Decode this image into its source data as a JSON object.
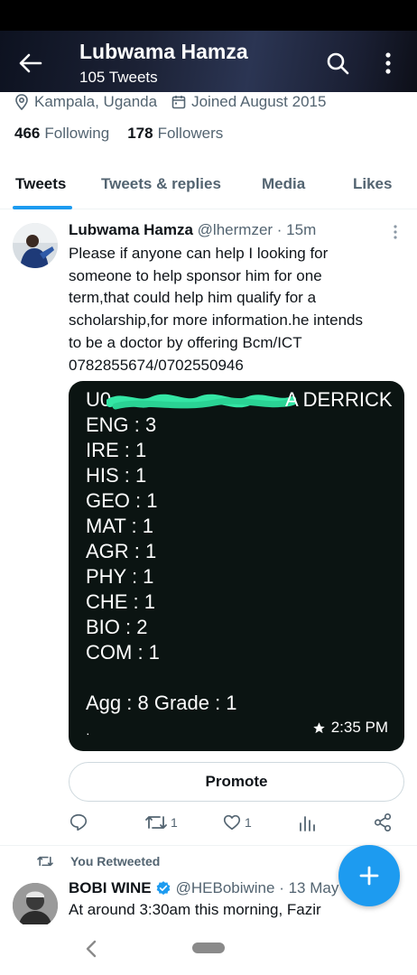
{
  "header": {
    "name": "Lubwama Hamza",
    "tweet_count": "105 Tweets",
    "back_icon": "arrow-left-icon",
    "search_icon": "search-icon",
    "more_icon": "more-vertical-icon"
  },
  "profile": {
    "location": "Kampala, Uganda",
    "joined": "Joined August 2015",
    "following_count": "466",
    "following_label": "Following",
    "followers_count": "178",
    "followers_label": "Followers"
  },
  "tabs": [
    {
      "label": "Tweets",
      "active": true
    },
    {
      "label": "Tweets & replies",
      "active": false
    },
    {
      "label": "Media",
      "active": false
    },
    {
      "label": "Likes",
      "active": false
    }
  ],
  "tweet": {
    "author_name": "Lubwama Hamza",
    "author_handle": "@lhermzer",
    "time": "· 15m",
    "text_lines": [
      "Please if anyone can help I looking for",
      "someone to help sponsor him for one",
      "term,that could help him qualify for a",
      "scholarship,for more information.he intends",
      "to be a doctor by offering Bcm/ICT",
      "0782855674/0702550946"
    ],
    "media": {
      "lines": [
        "U0",
        "A DERRICK",
        "ENG : 3",
        "IRE : 1",
        "HIS : 1",
        "GEO : 1",
        "MAT : 1",
        "AGR : 1",
        "PHY : 1",
        "CHE : 1",
        "BIO : 2",
        "COM : 1",
        "Agg : 8 Grade : 1"
      ],
      "dot": "·",
      "timestamp": "2:35 PM",
      "scribble_color": "#34e6a5",
      "background": "#0b1412"
    },
    "promote_label": "Promote",
    "actions": {
      "reply_count": "",
      "retweet_count": "1",
      "like_count": "1",
      "views_count": ""
    }
  },
  "retweet": {
    "label": "You Retweeted",
    "author_name": "BOBI WINE",
    "author_handle": "@HEBobiwine · 13 May",
    "text": "At around 3:30am this morning, Fazir",
    "verified_color": "#1d9bf0"
  },
  "colors": {
    "accent": "#1d9bf0",
    "secondary_text": "#536471",
    "primary_text": "#0f1419"
  }
}
